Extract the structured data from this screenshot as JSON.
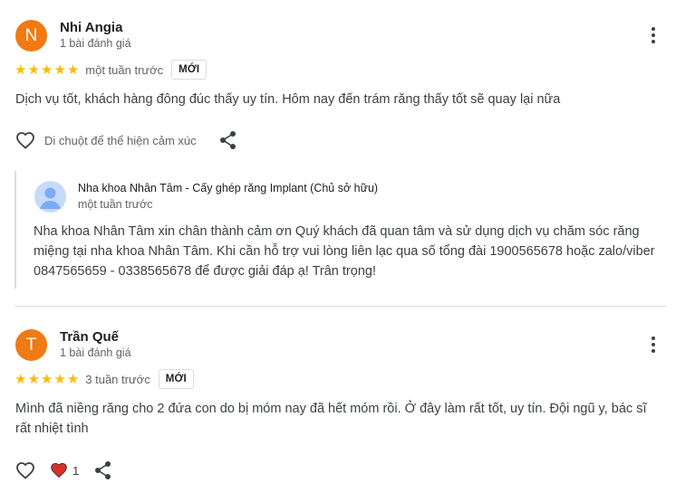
{
  "reviews": [
    {
      "avatar_initial": "N",
      "author": "Nhi Angia",
      "meta": "1 bài đánh giá",
      "rating": 5,
      "time": "một tuần trước",
      "badge": "MỚI",
      "text": "Dịch vụ tốt, khách hàng đông đúc thấy uy tín. Hôm nay đến trám răng thấy tốt sẽ quay lại nữa",
      "react_hint": "Di chuột để thể hiện cảm xúc",
      "owner_reply": {
        "name": "Nha khoa Nhân Tâm - Cấy ghép răng Implant (Chủ sở hữu)",
        "time": "một tuần trước",
        "text": "Nha khoa Nhân Tâm xin chân thành cảm ơn Quý khách đã quan tâm và sử dụng dịch vụ chăm sóc răng miệng tại nha khoa Nhân Tâm. Khi cần hỗ trợ vui lòng liên lạc qua số tổng đài 1900565678 hoặc zalo/viber 0847565659 - 0338565678 để được giải đáp ạ! Trân trọng!"
      }
    },
    {
      "avatar_initial": "T",
      "author": "Trần Quế",
      "meta": "1 bài đánh giá",
      "rating": 5,
      "time": "3 tuần trước",
      "badge": "MỚI",
      "text": "Mình đã niềng răng cho 2 đứa con do bị móm nay đã hết móm rồi. Ở đây làm rất tốt, uy tín. Đội ngũ y, bác sĩ rất nhiệt tình",
      "like_count": "1"
    }
  ],
  "colors": {
    "avatar_bg": "#f07a13",
    "star": "#fbbc04",
    "heart_filled": "#d93025"
  },
  "icons": [
    "heart-outline-icon",
    "share-icon",
    "more-vert-icon",
    "star-icon",
    "heart-filled-icon",
    "default-profile-icon"
  ]
}
